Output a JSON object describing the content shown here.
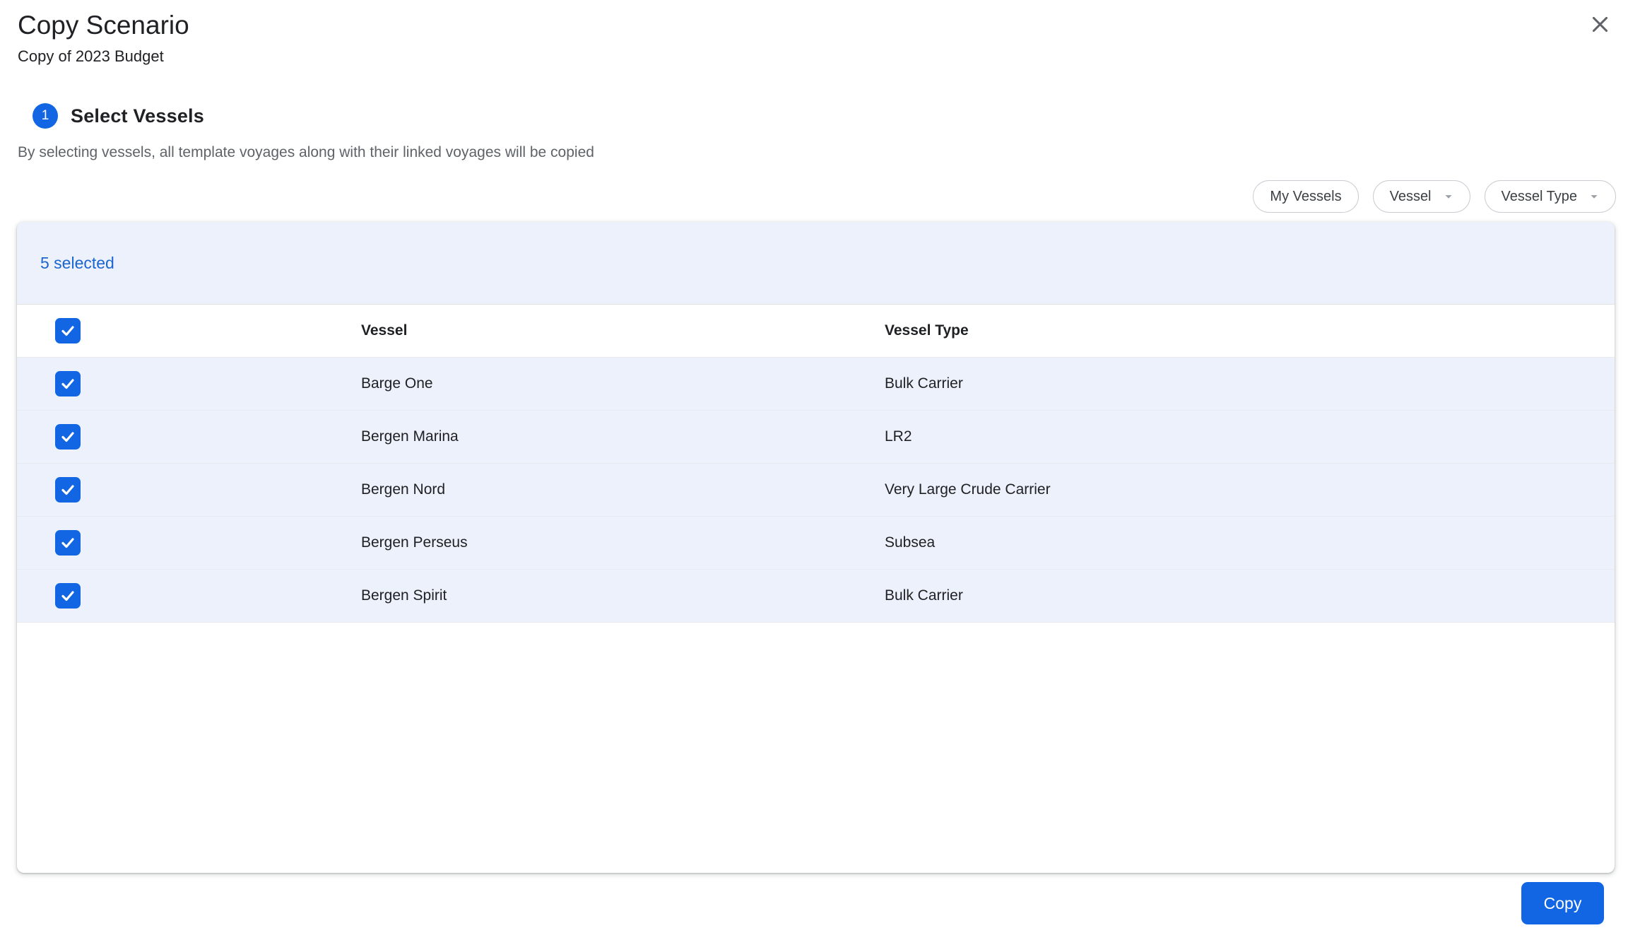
{
  "dialog": {
    "title": "Copy Scenario",
    "subtitle": "Copy of 2023 Budget"
  },
  "step": {
    "number": "1",
    "title": "Select Vessels",
    "description": "By selecting vessels, all template voyages along with their linked voyages will be copied"
  },
  "filters": {
    "my_vessels_label": "My Vessels",
    "vessel_label": "Vessel",
    "vessel_type_label": "Vessel Type"
  },
  "table": {
    "selected_count_label": "5 selected",
    "columns": {
      "vessel": "Vessel",
      "vessel_type": "Vessel Type"
    },
    "rows": [
      {
        "vessel": "Barge One",
        "vessel_type": "Bulk Carrier",
        "checked": true
      },
      {
        "vessel": "Bergen Marina",
        "vessel_type": "LR2",
        "checked": true
      },
      {
        "vessel": "Bergen Nord",
        "vessel_type": "Very Large Crude Carrier",
        "checked": true
      },
      {
        "vessel": "Bergen Perseus",
        "vessel_type": "Subsea",
        "checked": true
      },
      {
        "vessel": "Bergen Spirit",
        "vessel_type": "Bulk Carrier",
        "checked": true
      }
    ]
  },
  "actions": {
    "copy_label": "Copy"
  },
  "colors": {
    "accent_blue": "#1266E3",
    "selected_count_blue": "#1B66CE",
    "selected_row_bg": "#EDF1FB",
    "muted_text": "#5F6368"
  }
}
